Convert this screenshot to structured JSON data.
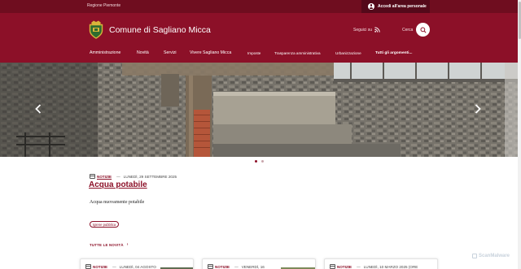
{
  "topbar": {
    "region": "Regione Piemonte",
    "login_label": "Accedi all'area personale"
  },
  "header": {
    "site_title": "Comune di Sagliano Micca",
    "follow_label": "Seguici su",
    "search_label": "Cerca"
  },
  "nav": {
    "items": [
      {
        "label": "Amministrazione"
      },
      {
        "label": "Novità"
      },
      {
        "label": "Servizi"
      },
      {
        "label": "Vivere Sagliano Micca"
      },
      {
        "label": "Imposte"
      },
      {
        "label": "Trasparenza amministrativa"
      },
      {
        "label": "Urbanizzazione"
      },
      {
        "label": "Tutti gli argomenti..."
      }
    ]
  },
  "carousel": {
    "slide_count": 2,
    "active_slide": 1
  },
  "news": {
    "category": "NOTIZIE",
    "separator": "—",
    "date": "LUNEDÌ, 29 SETTEMBRE 2025",
    "title": "Acqua potabile",
    "text": "Acqua nuovamente potabile",
    "tag": "Igiene pubblica",
    "all_news_label": "TUTTE LE NOVITÀ",
    "all_news_chevron": "›"
  },
  "cards": [
    {
      "category": "NOTIZIE",
      "separator": "—",
      "date": "LUNEDÌ, 04 AGOSTO"
    },
    {
      "category": "NOTIZIE",
      "separator": "—",
      "date": "VENERDÌ, 16"
    },
    {
      "category": "NOTIZIE",
      "separator": "—",
      "date": "LUNEDÌ, 10 MARZO 2025 (ORE"
    }
  ],
  "watermark": "ScanMalware",
  "colors": {
    "brand": "#8c1028",
    "brand_dark": "#6f0d1f",
    "login_bg": "#54091a"
  },
  "icons": [
    "user-icon",
    "crest-logo",
    "rss-icon",
    "search-icon",
    "chevron-left-icon",
    "chevron-right-icon",
    "calendar-icon"
  ]
}
